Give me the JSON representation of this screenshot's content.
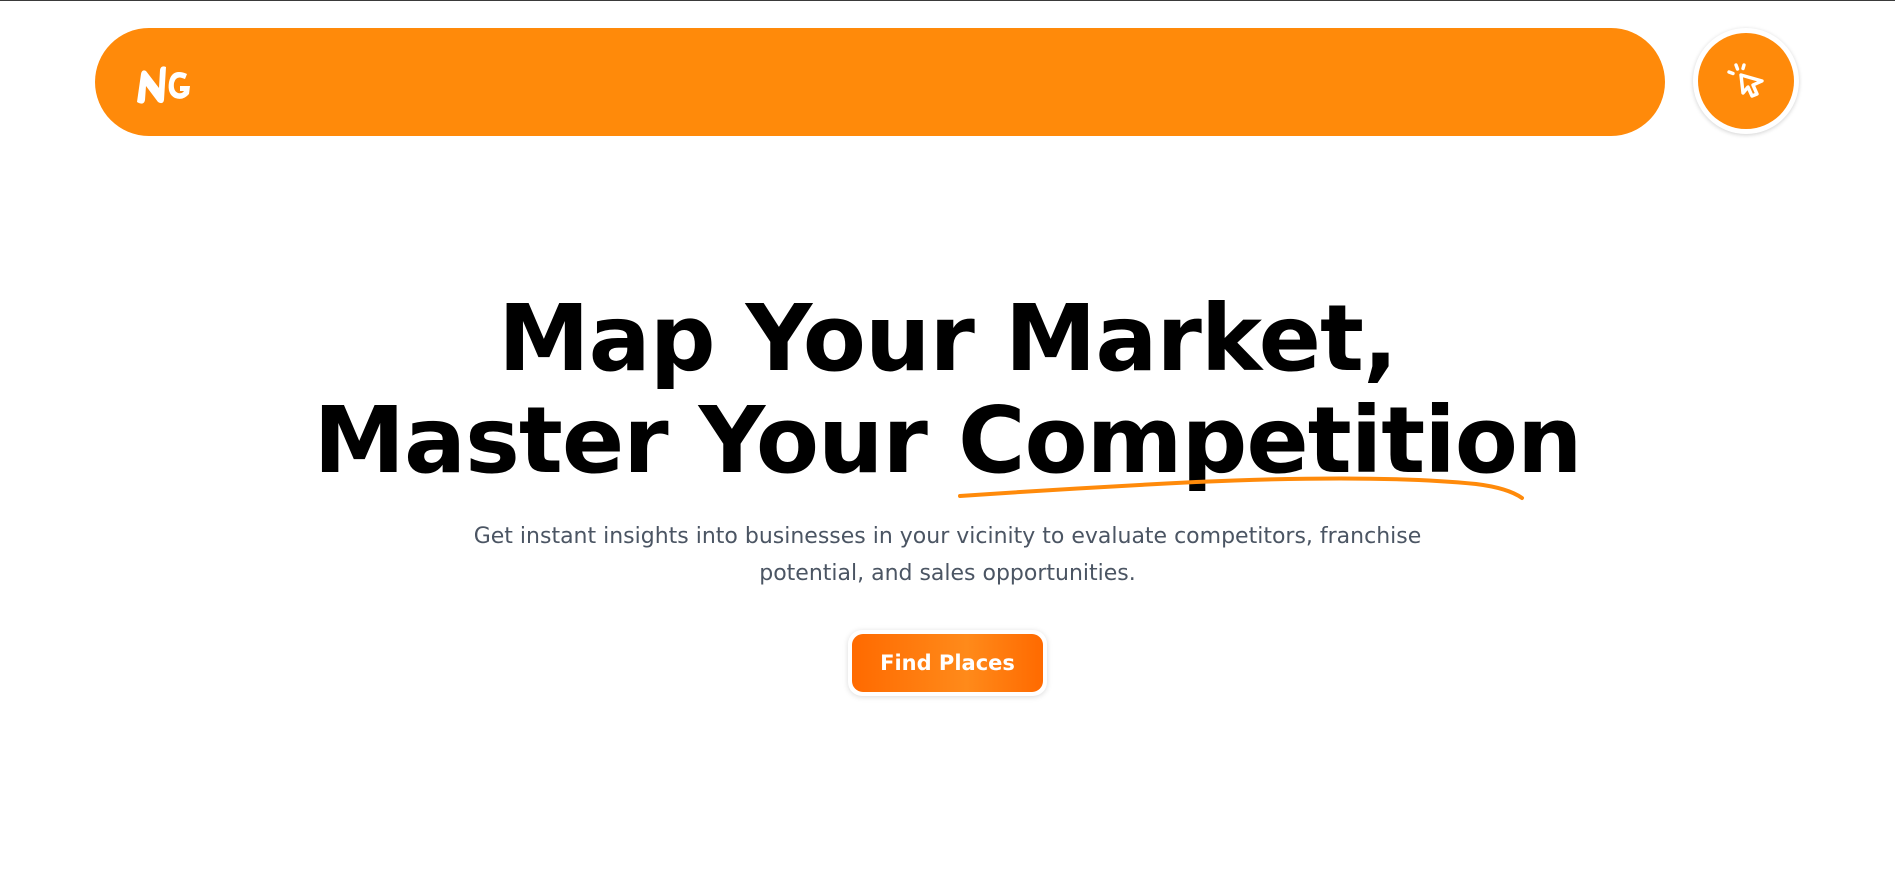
{
  "header": {
    "logo_icon": "ng-logo-icon",
    "action_icon": "tap-pointer-icon",
    "brand_color": "#ff8a0a"
  },
  "hero": {
    "headline_line1": "Map Your Market,",
    "headline_line2_prefix": "Master Your ",
    "headline_line2_highlight": "Competition",
    "subtitle": "Get instant insights into businesses in your vicinity to evaluate competitors, franchise potential, and sales opportunities.",
    "cta_label": "Find Places",
    "underline_color": "#ff8a0a"
  }
}
